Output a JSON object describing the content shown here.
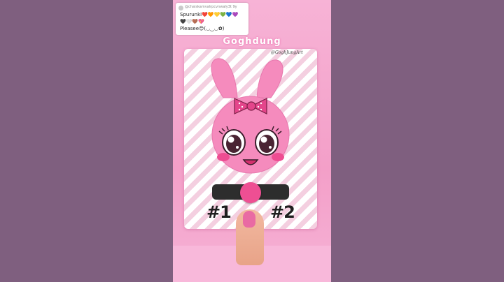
{
  "comment": {
    "username": "@chaiskamvalrpcvnwaly3t 9y",
    "line1": "Spurunki❤️🧡💛💚💙💜",
    "line2": "🖤🤍🤎💖",
    "line3": "Pleasee😊(◡‿◡✿)"
  },
  "watermark": "Goghdung",
  "credit": "@GoghJungArt",
  "options": {
    "left": "#1",
    "right": "#2"
  },
  "slider": {
    "position": 0.5
  },
  "colors": {
    "bunny": "#f58bbd",
    "bow": "#e4458b",
    "knob": "#ee4f93"
  }
}
